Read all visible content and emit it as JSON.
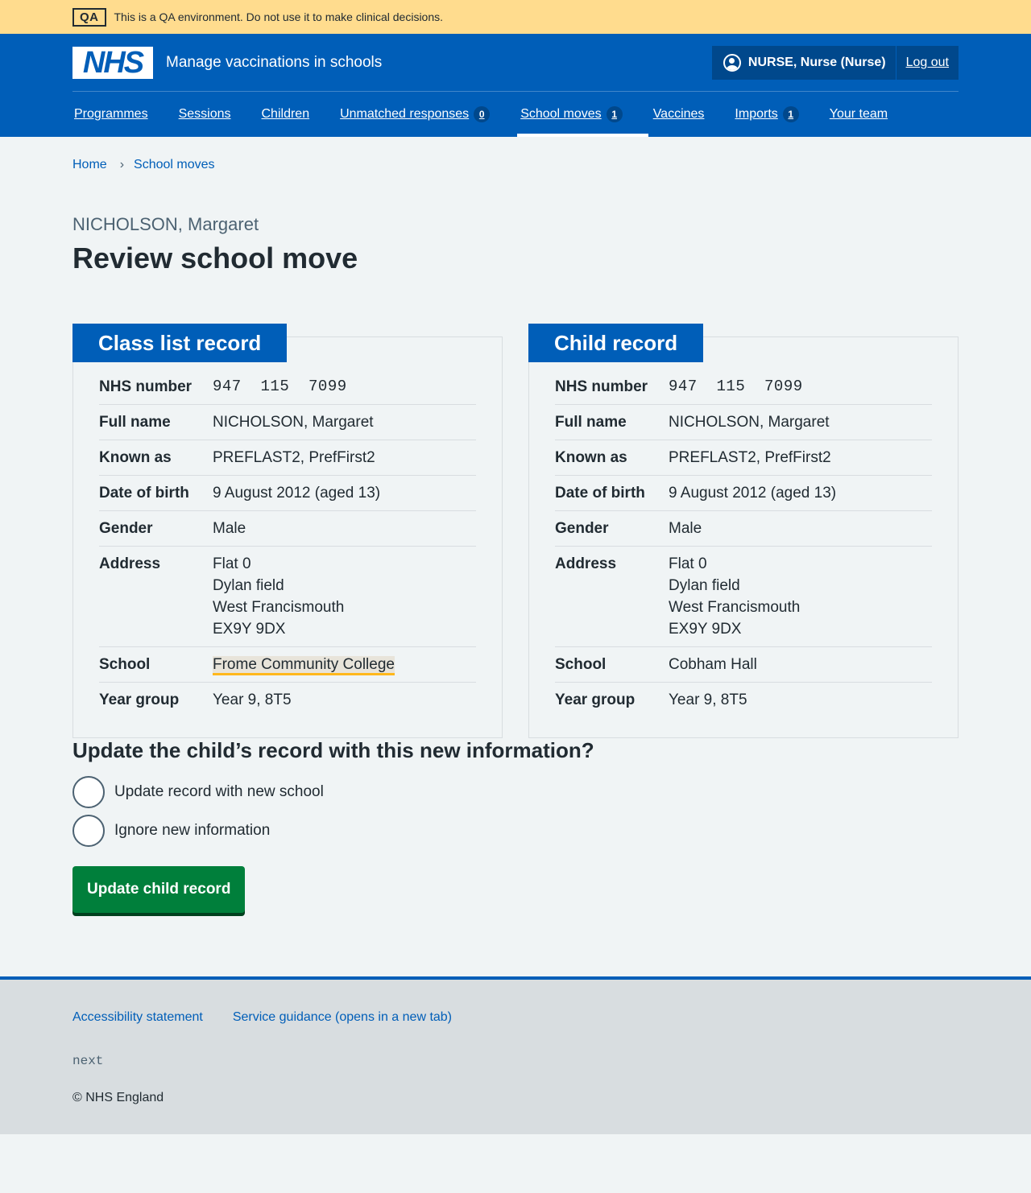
{
  "qa_banner": {
    "tag": "QA",
    "message": "This is a QA environment. Do not use it to make clinical decisions."
  },
  "header": {
    "logo_text": "NHS",
    "service_name": "Manage vaccinations in schools",
    "user": "NURSE, Nurse (Nurse)",
    "logout_label": "Log out"
  },
  "nav": {
    "programmes": "Programmes",
    "sessions": "Sessions",
    "children": "Children",
    "unmatched": "Unmatched responses",
    "unmatched_count": "0",
    "school_moves": "School moves",
    "school_moves_count": "1",
    "vaccines": "Vaccines",
    "imports": "Imports",
    "imports_count": "1",
    "your_team": "Your team"
  },
  "breadcrumb": {
    "home": "Home",
    "current": "School moves",
    "separator": "›"
  },
  "page": {
    "caption": "NICHOLSON, Margaret",
    "title": "Review school move"
  },
  "labels": {
    "nhs_number": "NHS number",
    "full_name": "Full name",
    "known_as": "Known as",
    "dob": "Date of birth",
    "gender": "Gender",
    "address": "Address",
    "school": "School",
    "year_group": "Year group"
  },
  "class_list": {
    "heading": "Class list record",
    "nhs_number": "947  115  7099",
    "full_name": "NICHOLSON, Margaret",
    "known_as": "PREFLAST2, PrefFirst2",
    "dob": "9 August 2012 (aged 13)",
    "gender": "Male",
    "address": [
      "Flat 0",
      "Dylan field",
      "West Francismouth",
      "EX9Y 9DX"
    ],
    "school": "Frome Community College",
    "year_group": "Year 9, 8T5"
  },
  "child_record": {
    "heading": "Child record",
    "nhs_number": "947  115  7099",
    "full_name": "NICHOLSON, Margaret",
    "known_as": "PREFLAST2, PrefFirst2",
    "dob": "9 August 2012 (aged 13)",
    "gender": "Male",
    "address": [
      "Flat 0",
      "Dylan field",
      "West Francismouth",
      "EX9Y 9DX"
    ],
    "school": "Cobham Hall",
    "year_group": "Year 9, 8T5"
  },
  "question": {
    "legend": "Update the child’s record with this new information?",
    "options": [
      "Update record with new school",
      "Ignore new information"
    ]
  },
  "submit_label": "Update child record",
  "footer": {
    "accessibility": "Accessibility statement",
    "guidance": "Service guidance (opens in a new tab)",
    "version": "next",
    "copyright": "© NHS England"
  },
  "colors": {
    "nhs_blue": "#005eb8",
    "qa_yellow": "#ffdc8e",
    "button_green": "#007f3b",
    "highlight_border": "#ffb81c"
  }
}
